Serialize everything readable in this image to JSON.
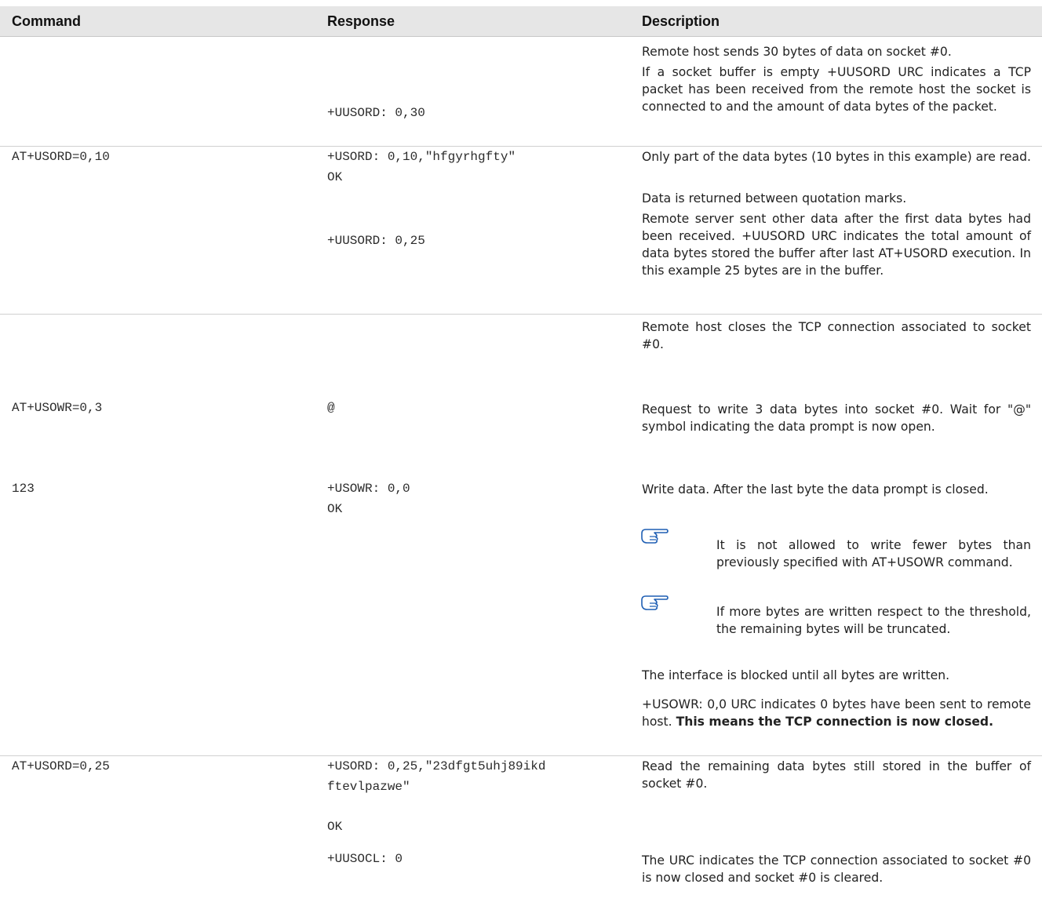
{
  "header": {
    "command": "Command",
    "response": "Response",
    "description": "Description"
  },
  "rows": {
    "r1": {
      "desc1": "Remote host sends 30 bytes of data on socket #0.",
      "desc2": "If a socket buffer is empty +UUSORD URC indicates a TCP packet has been received from the remote host the socket is connected to and the amount of data bytes of the packet.",
      "response": "+UUSORD: 0,30"
    },
    "r2": {
      "command": "AT+USORD=0,10",
      "response1": "+USORD: 0,10,\"hfgyrhgfty\"",
      "response2": "OK",
      "desc1": "Only part of the data bytes (10 bytes in this example) are read.",
      "desc2": "Data is returned between quotation marks.",
      "response3": "+UUSORD: 0,25",
      "desc3": "Remote server sent other data after the first data bytes had been received. +UUSORD URC indicates the total amount of data bytes stored the buffer after last AT+USORD execution. In this example 25 bytes are in the buffer."
    },
    "r3": {
      "desc": "Remote host closes the TCP connection associated to socket #0."
    },
    "r4": {
      "command": "AT+USOWR=0,3",
      "response": "@",
      "desc": "Request to write 3 data bytes into socket #0. Wait for \"@\" symbol indicating the data prompt is now open."
    },
    "r5": {
      "command": "123",
      "response1": "+USOWR: 0,0",
      "response2": "OK",
      "desc1": "Write data. After the last byte the data prompt is closed.",
      "note1": "It is not allowed to write fewer bytes than previously specified with AT+USOWR command.",
      "note2": "If more bytes are written respect to the threshold, the remaining bytes will be truncated.",
      "desc2": "The interface is blocked until all bytes are written.",
      "desc3_plain": "+USOWR: 0,0 URC indicates 0 bytes have been sent to remote host.",
      "desc3_bold": "This means the TCP connection is now closed."
    },
    "r6": {
      "command": "AT+USORD=0,25",
      "response1_line1": "+USORD: 0,25,\"23dfgt5uhj89ikd",
      "response1_line2": "ftevlpazwe\"",
      "desc1": "Read the remaining data bytes still stored in the buffer of socket #0.",
      "response2": "OK",
      "response3": "+UUSOCL: 0",
      "desc2": "The URC indicates the TCP connection associated to socket #0 is now closed and socket #0 is cleared."
    }
  },
  "colors": {
    "header_bg": "#e6e6e6",
    "note_icon": "#1f5fb4"
  }
}
